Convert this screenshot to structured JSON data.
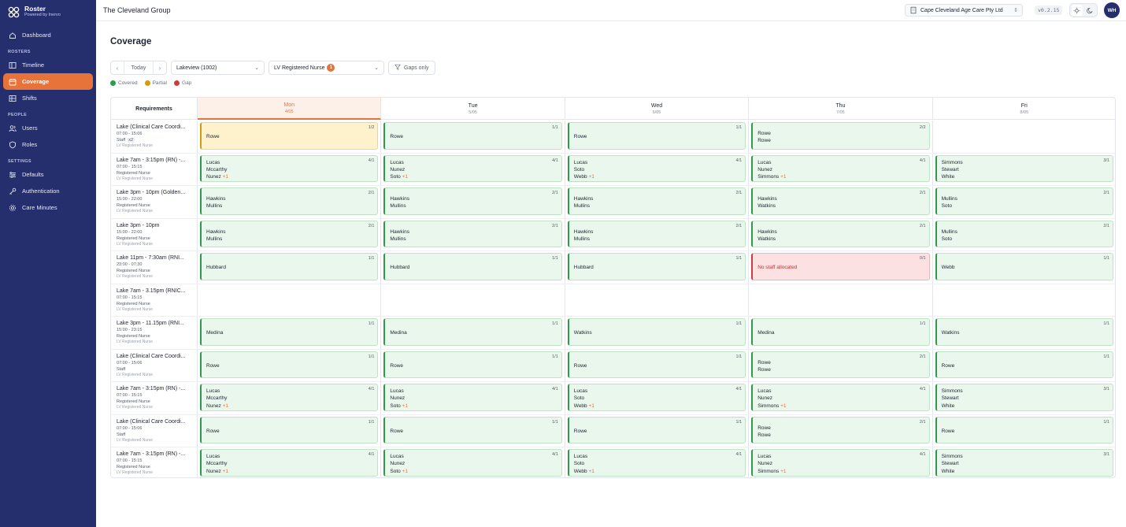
{
  "app": {
    "name": "Roster",
    "tagline": "Powered by Inervo"
  },
  "sidebar": {
    "dashboard": "Dashboard",
    "rosters_heading": "ROSTERS",
    "timeline": "Timeline",
    "coverage": "Coverage",
    "shifts": "Shifts",
    "people_heading": "PEOPLE",
    "users": "Users",
    "roles": "Roles",
    "settings_heading": "SETTINGS",
    "defaults": "Defaults",
    "authentication": "Authentication",
    "care_minutes": "Care Minutes"
  },
  "header": {
    "org": "The Cleveland Group",
    "facility": "Cape Cleveland Age Care Pty Ltd",
    "version": "v0.2.15",
    "user_initials": "WH"
  },
  "page": {
    "title": "Coverage"
  },
  "toolbar": {
    "today": "Today",
    "location": "Lakeview (1002)",
    "role_filter": "LV Registered Nurse",
    "role_filter_count": "1",
    "gaps_only": "Gaps only"
  },
  "legend": {
    "covered": "Covered",
    "partial": "Partial",
    "gap": "Gap"
  },
  "colors": {
    "covered": "#2f9a4a",
    "partial": "#d49a12",
    "gap": "#d23b3b",
    "accent": "#e8733a",
    "sidebar": "#252f6e"
  },
  "grid": {
    "requirements_label": "Requirements",
    "days": [
      {
        "name": "Mon",
        "date": "4/05"
      },
      {
        "name": "Tue",
        "date": "5/05"
      },
      {
        "name": "Wed",
        "date": "6/05"
      },
      {
        "name": "Thu",
        "date": "7/05"
      },
      {
        "name": "Fri",
        "date": "8/05"
      }
    ],
    "rows": [
      {
        "title": "Lake (Clinical Care Coordi...",
        "time": "07:00 - 15:06",
        "role": "Staff",
        "role_extra": "x2",
        "sub": "LV Registered Nurse",
        "cells": [
          {
            "status": "partial",
            "ratio": "1/2",
            "names": [
              "Rowe"
            ]
          },
          {
            "status": "covered",
            "ratio": "1/1",
            "names": [
              "Rowe"
            ]
          },
          {
            "status": "covered",
            "ratio": "1/1",
            "names": [
              "Rowe"
            ]
          },
          {
            "status": "covered",
            "ratio": "2/2",
            "names": [
              "Rowe",
              "Rowe"
            ]
          },
          null
        ]
      },
      {
        "title": "Lake 7am - 3:15pm (RN) -...",
        "time": "07:00 - 15:15",
        "role": "Registered Nurse",
        "sub": "LV Registered Nurse",
        "cells": [
          {
            "status": "covered",
            "ratio": "4/1",
            "names": [
              "Lucas",
              "Mccarthy",
              "Nunez"
            ],
            "more": "+1"
          },
          {
            "status": "covered",
            "ratio": "4/1",
            "names": [
              "Lucas",
              "Nunez",
              "Soto"
            ],
            "more": "+1"
          },
          {
            "status": "covered",
            "ratio": "4/1",
            "names": [
              "Lucas",
              "Soto",
              "Webb"
            ],
            "more": "+1"
          },
          {
            "status": "covered",
            "ratio": "4/1",
            "names": [
              "Lucas",
              "Nunez",
              "Simmons"
            ],
            "more": "+1"
          },
          {
            "status": "covered",
            "ratio": "3/1",
            "names": [
              "Simmons",
              "Stewart",
              "White"
            ]
          }
        ]
      },
      {
        "title": "Lake 3pm - 10pm (Golden...",
        "time": "15:00 - 22:00",
        "role": "Registered Nurse",
        "sub": "LV Registered Nurse",
        "cells": [
          {
            "status": "covered",
            "ratio": "2/1",
            "names": [
              "Hawkins",
              "Mullins"
            ]
          },
          {
            "status": "covered",
            "ratio": "2/1",
            "names": [
              "Hawkins",
              "Mullins"
            ]
          },
          {
            "status": "covered",
            "ratio": "2/1",
            "names": [
              "Hawkins",
              "Mullins"
            ]
          },
          {
            "status": "covered",
            "ratio": "2/1",
            "names": [
              "Hawkins",
              "Watkins"
            ]
          },
          {
            "status": "covered",
            "ratio": "2/1",
            "names": [
              "Mullins",
              "Soto"
            ]
          }
        ]
      },
      {
        "title": "Lake 3pm - 10pm",
        "time": "15:00 - 22:00",
        "role": "Registered Nurse",
        "sub": "LV Registered Nurse",
        "cells": [
          {
            "status": "covered",
            "ratio": "2/1",
            "names": [
              "Hawkins",
              "Mullins"
            ]
          },
          {
            "status": "covered",
            "ratio": "2/1",
            "names": [
              "Hawkins",
              "Mullins"
            ]
          },
          {
            "status": "covered",
            "ratio": "2/1",
            "names": [
              "Hawkins",
              "Mullins"
            ]
          },
          {
            "status": "covered",
            "ratio": "2/1",
            "names": [
              "Hawkins",
              "Watkins"
            ]
          },
          {
            "status": "covered",
            "ratio": "2/1",
            "names": [
              "Mullins",
              "Soto"
            ]
          }
        ]
      },
      {
        "title": "Lake 11pm - 7:30am (RNI...",
        "time": "23:00 - 07:30",
        "role": "Registered Nurse",
        "sub": "LV Registered Nurse",
        "cells": [
          {
            "status": "covered",
            "ratio": "1/1",
            "names": [
              "Hubbard"
            ]
          },
          {
            "status": "covered",
            "ratio": "1/1",
            "names": [
              "Hubbard"
            ]
          },
          {
            "status": "covered",
            "ratio": "1/1",
            "names": [
              "Hubbard"
            ]
          },
          {
            "status": "gap",
            "ratio": "0/1",
            "gap_text": "No staff allocated"
          },
          {
            "status": "covered",
            "ratio": "1/1",
            "names": [
              "Webb"
            ]
          }
        ]
      },
      {
        "title": "Lake 7am - 3.15pm (RNIC...",
        "time": "07:00 - 15:15",
        "role": "Registered Nurse",
        "sub": "LV Registered Nurse",
        "cells": [
          null,
          null,
          null,
          null,
          null
        ]
      },
      {
        "title": "Lake 3pm - 11.15pm (RNI...",
        "time": "15:00 - 23:15",
        "role": "Registered Nurse",
        "sub": "LV Registered Nurse",
        "cells": [
          {
            "status": "covered",
            "ratio": "1/1",
            "names": [
              "Medina"
            ]
          },
          {
            "status": "covered",
            "ratio": "1/1",
            "names": [
              "Medina"
            ]
          },
          {
            "status": "covered",
            "ratio": "1/1",
            "names": [
              "Watkins"
            ]
          },
          {
            "status": "covered",
            "ratio": "1/1",
            "names": [
              "Medina"
            ]
          },
          {
            "status": "covered",
            "ratio": "1/1",
            "names": [
              "Watkins"
            ]
          }
        ]
      },
      {
        "title": "Lake (Clinical Care Coordi...",
        "time": "07:00 - 15:06",
        "role": "Staff",
        "sub": "LV Registered Nurse",
        "cells": [
          {
            "status": "covered",
            "ratio": "1/1",
            "names": [
              "Rowe"
            ]
          },
          {
            "status": "covered",
            "ratio": "1/1",
            "names": [
              "Rowe"
            ]
          },
          {
            "status": "covered",
            "ratio": "1/1",
            "names": [
              "Rowe"
            ]
          },
          {
            "status": "covered",
            "ratio": "2/1",
            "names": [
              "Rowe",
              "Rowe"
            ]
          },
          {
            "status": "covered",
            "ratio": "1/1",
            "names": [
              "Rowe"
            ]
          }
        ]
      },
      {
        "title": "Lake 7am - 3:15pm (RN) -...",
        "time": "07:00 - 15:15",
        "role": "Registered Nurse",
        "sub": "LV Registered Nurse",
        "cells": [
          {
            "status": "covered",
            "ratio": "4/1",
            "names": [
              "Lucas",
              "Mccarthy",
              "Nunez"
            ],
            "more": "+1"
          },
          {
            "status": "covered",
            "ratio": "4/1",
            "names": [
              "Lucas",
              "Nunez",
              "Soto"
            ],
            "more": "+1"
          },
          {
            "status": "covered",
            "ratio": "4/1",
            "names": [
              "Lucas",
              "Soto",
              "Webb"
            ],
            "more": "+1"
          },
          {
            "status": "covered",
            "ratio": "4/1",
            "names": [
              "Lucas",
              "Nunez",
              "Simmons"
            ],
            "more": "+1"
          },
          {
            "status": "covered",
            "ratio": "3/1",
            "names": [
              "Simmons",
              "Stewart",
              "White"
            ]
          }
        ]
      },
      {
        "title": "Lake (Clinical Care Coordi...",
        "time": "07:00 - 15:06",
        "role": "Staff",
        "sub": "LV Registered Nurse",
        "cells": [
          {
            "status": "covered",
            "ratio": "1/1",
            "names": [
              "Rowe"
            ]
          },
          {
            "status": "covered",
            "ratio": "1/1",
            "names": [
              "Rowe"
            ]
          },
          {
            "status": "covered",
            "ratio": "1/1",
            "names": [
              "Rowe"
            ]
          },
          {
            "status": "covered",
            "ratio": "2/1",
            "names": [
              "Rowe",
              "Rowe"
            ]
          },
          {
            "status": "covered",
            "ratio": "1/1",
            "names": [
              "Rowe"
            ]
          }
        ]
      },
      {
        "title": "Lake 7am - 3:15pm (RN) -...",
        "time": "07:00 - 15:15",
        "role": "Registered Nurse",
        "sub": "LV Registered Nurse",
        "cells": [
          {
            "status": "covered",
            "ratio": "4/1",
            "names": [
              "Lucas",
              "Mccarthy",
              "Nunez"
            ],
            "more": "+1"
          },
          {
            "status": "covered",
            "ratio": "4/1",
            "names": [
              "Lucas",
              "Nunez",
              "Soto"
            ],
            "more": "+1"
          },
          {
            "status": "covered",
            "ratio": "4/1",
            "names": [
              "Lucas",
              "Soto",
              "Webb"
            ],
            "more": "+1"
          },
          {
            "status": "covered",
            "ratio": "4/1",
            "names": [
              "Lucas",
              "Nunez",
              "Simmons"
            ],
            "more": "+1"
          },
          {
            "status": "covered",
            "ratio": "3/1",
            "names": [
              "Simmons",
              "Stewart",
              "White"
            ]
          }
        ]
      }
    ]
  }
}
